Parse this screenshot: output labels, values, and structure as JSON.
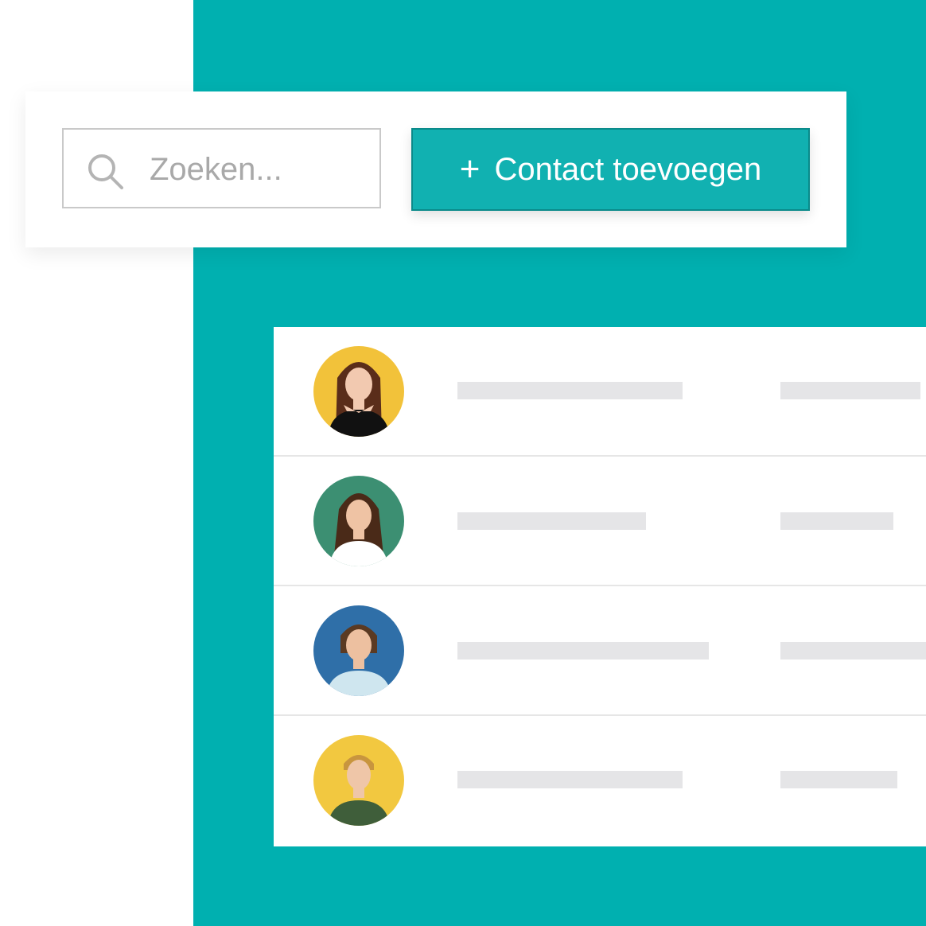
{
  "search": {
    "placeholder": "Zoeken...",
    "icon": "search-icon"
  },
  "add_contact": {
    "label": "Contact toevoegen",
    "icon": "plus-icon"
  },
  "colors": {
    "accent": "#00b0b0",
    "button": "#11b1b1",
    "placeholder_bar": "#e5e5e7"
  },
  "contacts": [
    {
      "avatar_bg": "#f2c23a",
      "hair": "#5a2d1a",
      "skin": "#f2c9b0",
      "shirt": "#111111"
    },
    {
      "avatar_bg": "#3c8f72",
      "hair": "#4a2a18",
      "skin": "#efc3a4",
      "shirt": "#ffffff"
    },
    {
      "avatar_bg": "#2f6fa8",
      "hair": "#5b3a22",
      "skin": "#edc0a0",
      "shirt": "#cfe6ef"
    },
    {
      "avatar_bg": "#f2c840",
      "hair": "#c8953e",
      "skin": "#efc6a8",
      "shirt": "#3f5e3a"
    }
  ]
}
